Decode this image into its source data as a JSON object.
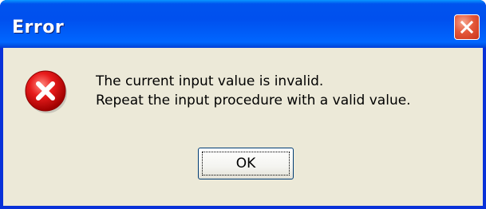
{
  "window": {
    "title": "Error"
  },
  "icons": {
    "close": "close-icon",
    "error": "error-icon"
  },
  "message": {
    "line1": "The current input value is invalid.",
    "line2": "Repeat the input procedure with a valid value."
  },
  "buttons": {
    "ok_label": "OK"
  },
  "colors": {
    "titlebar": "#0054e3",
    "dialog_background": "#ece9d8",
    "close_button": "#e4583a",
    "error_red": "#d10000"
  }
}
